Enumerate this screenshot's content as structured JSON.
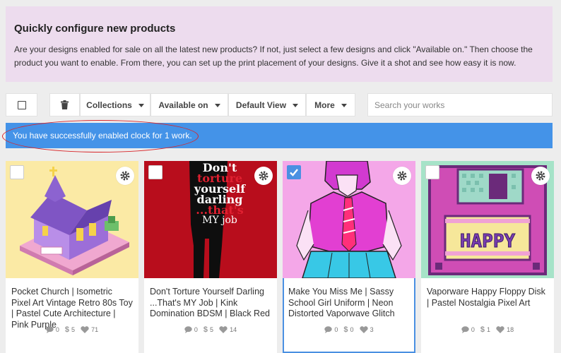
{
  "banner": {
    "title": "Quickly configure new products",
    "text": "Are your designs enabled for sale on all the latest new products? If not, just select a few designs and click \"Available on.\" Then choose the product you want to enable. From there, you can set up the print placement of your designs. Give it a shot and see how easy it is now."
  },
  "toolbar": {
    "collections": "Collections",
    "available_on": "Available on",
    "default_view": "Default View",
    "more": "More"
  },
  "search": {
    "placeholder": "Search your works"
  },
  "alert": {
    "text": "You have successfully enabled clock for 1 work."
  },
  "cards": [
    {
      "title": "Pocket Church | Isometric Pixel Art Vintage Retro 80s Toy | Pastel Cute Architecture | Pink Purple",
      "comments": "0",
      "price": "5",
      "likes": "71",
      "selected": false
    },
    {
      "title": "Don't Torture Yourself Darling ...That's MY Job | Kink Domination BDSM | Black Red",
      "comments": "0",
      "price": "5",
      "likes": "14",
      "selected": false,
      "art_text": [
        "Don't",
        "torture",
        "yourself",
        "darling",
        "...that's",
        "MY job"
      ]
    },
    {
      "title": "Make You Miss Me | Sassy School Girl Uniform | Neon Distorted Vaporwave Glitch",
      "comments": "0",
      "price": "0",
      "likes": "3",
      "selected": true
    },
    {
      "title": "Vaporware Happy Floppy Disk | Pastel Nostalgia Pixel Art",
      "comments": "0",
      "price": "1",
      "likes": "18",
      "selected": false,
      "art_text": [
        "HAPPY"
      ]
    }
  ],
  "colors": {
    "banner_bg": "#eddcee",
    "alert_bg": "#4493e8",
    "selected_border": "#4a90e2",
    "annotation": "#d8262a"
  }
}
